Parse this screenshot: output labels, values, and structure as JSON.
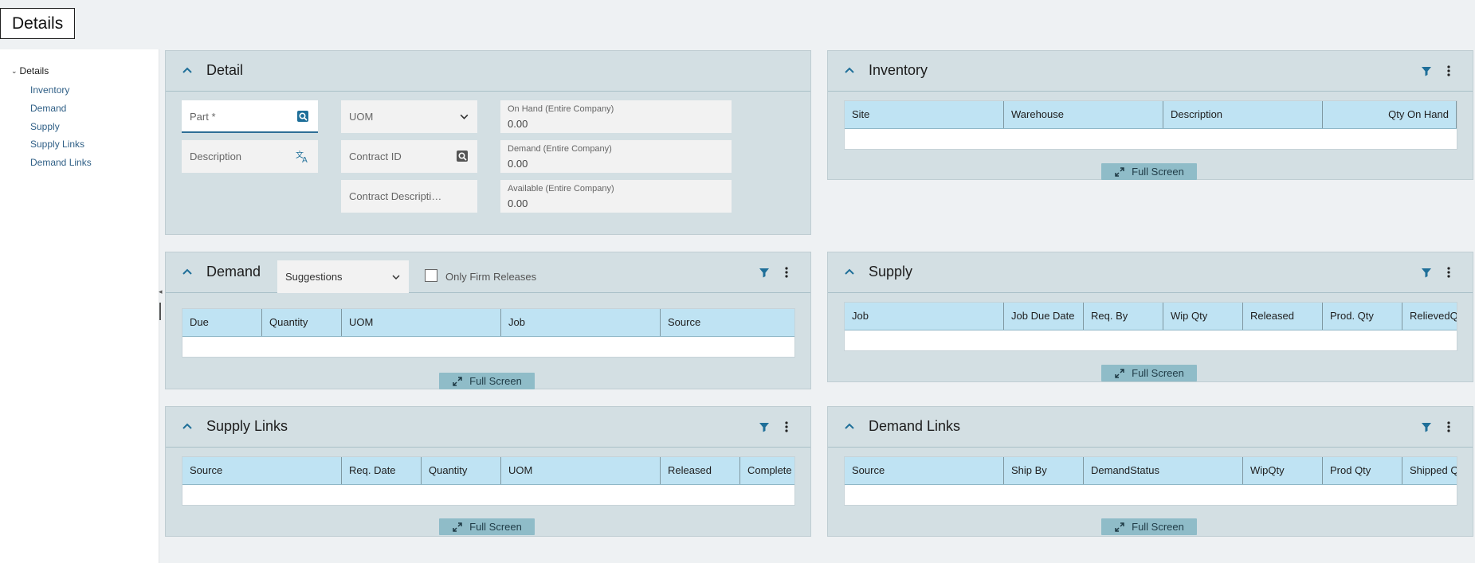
{
  "page": {
    "title": "Details"
  },
  "sidebar": {
    "root": "Details",
    "items": [
      "Inventory",
      "Demand",
      "Supply",
      "Supply Links",
      "Demand Links"
    ]
  },
  "detail": {
    "title": "Detail",
    "part_label": "Part *",
    "description_label": "Description",
    "uom_label": "UOM",
    "contract_id_label": "Contract ID",
    "contract_description_label": "Contract Descripti…",
    "on_hand_label": "On Hand (Entire Company)",
    "on_hand_value": "0.00",
    "demand_label": "Demand (Entire Company)",
    "demand_value": "0.00",
    "available_label": "Available (Entire Company)",
    "available_value": "0.00"
  },
  "inventory": {
    "title": "Inventory",
    "columns": [
      "Site",
      "Warehouse",
      "Description",
      "Qty On Hand"
    ],
    "fullscreen_label": "Full Screen"
  },
  "demand": {
    "title": "Demand",
    "dropdown_value": "Suggestions",
    "only_firm_label": "Only Firm Releases",
    "columns": [
      "Due",
      "Quantity",
      "UOM",
      "Job",
      "Source"
    ],
    "fullscreen_label": "Full Screen"
  },
  "supply": {
    "title": "Supply",
    "columns": [
      "Job",
      "Job Due Date",
      "Req. By",
      "Wip Qty",
      "Released",
      "Prod. Qty",
      "RelievedQ"
    ],
    "fullscreen_label": "Full Screen"
  },
  "supply_links": {
    "title": "Supply Links",
    "columns": [
      "Source",
      "Req. Date",
      "Quantity",
      "UOM",
      "Released",
      "Complete"
    ],
    "fullscreen_label": "Full Screen"
  },
  "demand_links": {
    "title": "Demand Links",
    "columns": [
      "Source",
      "Ship By",
      "DemandStatus",
      "WipQty",
      "Prod Qty",
      "Shipped Q"
    ],
    "fullscreen_label": "Full Screen"
  },
  "colors": {
    "panel_bg": "#d3dfe3",
    "grid_header_bg": "#bfe3f3",
    "accent": "#1f6f99",
    "fullscreen_bg": "#8fbcc8"
  }
}
